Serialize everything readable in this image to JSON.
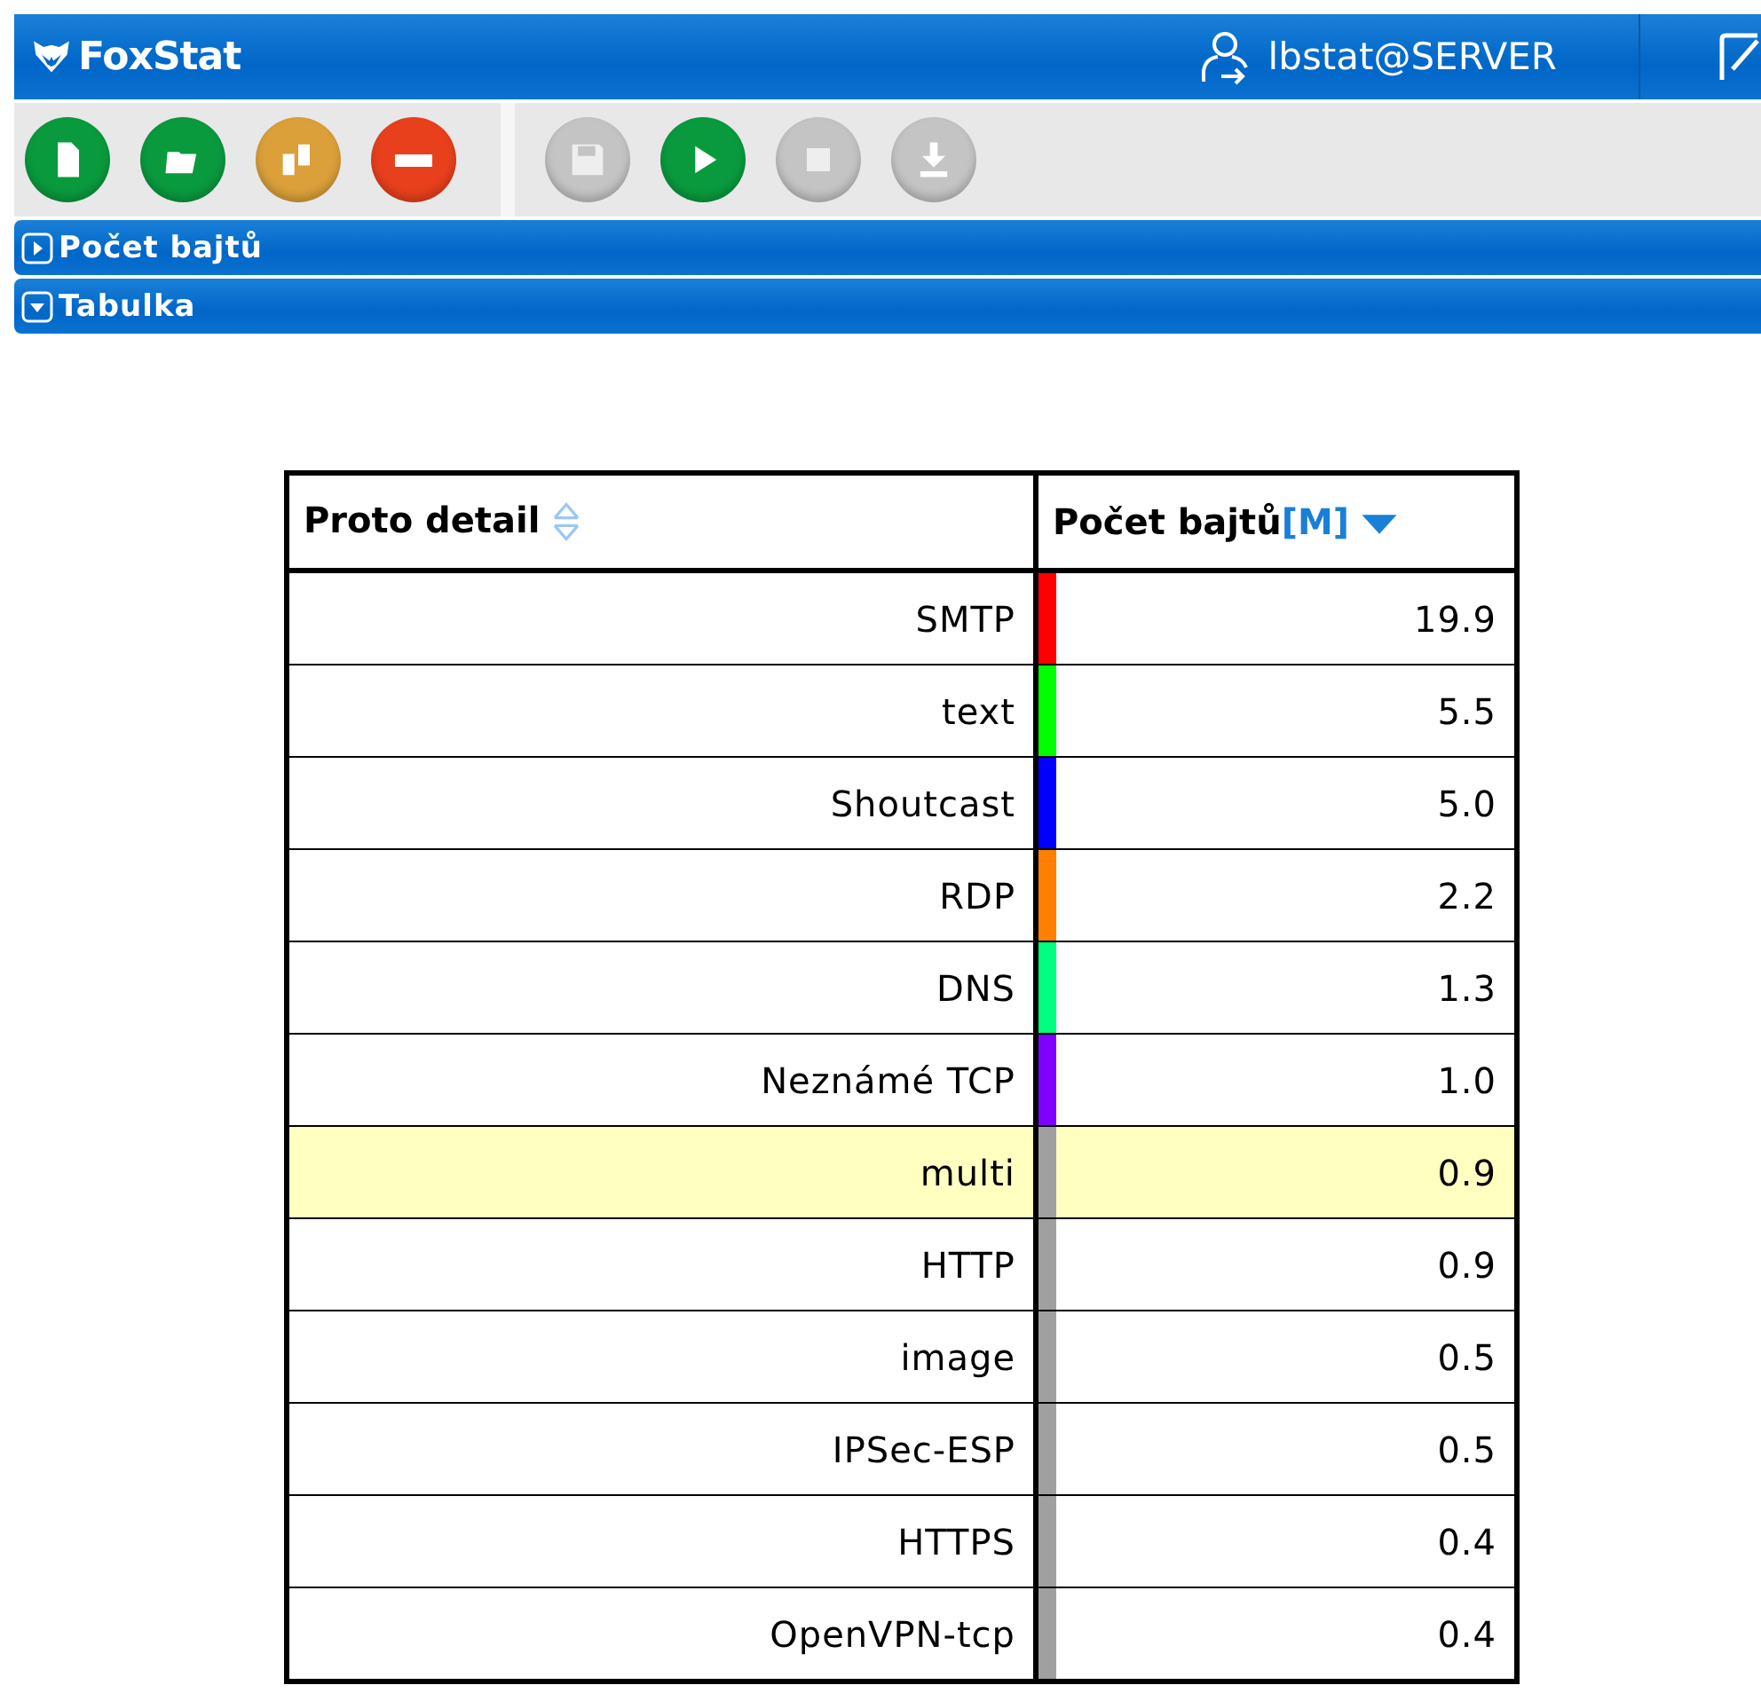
{
  "app": {
    "title": "FoxStat",
    "user": "lbstat@SERVER"
  },
  "toolbar": [
    {
      "kind": "new",
      "disabled": false
    },
    {
      "kind": "open",
      "disabled": false
    },
    {
      "kind": "copy",
      "disabled": false
    },
    {
      "kind": "remove",
      "disabled": false
    },
    {
      "kind": "save",
      "disabled": true
    },
    {
      "kind": "play",
      "disabled": false
    },
    {
      "kind": "stop",
      "disabled": true
    },
    {
      "kind": "download",
      "disabled": true
    }
  ],
  "sections": [
    {
      "title": "Počet bajtů",
      "expanded": false
    },
    {
      "title": "Tabulka",
      "expanded": true
    }
  ],
  "table": {
    "columns": [
      {
        "label": "Proto detail",
        "sorted": false
      },
      {
        "label": "Počet bajtů",
        "unit": "[M]",
        "sorted": true
      }
    ],
    "rows": [
      {
        "name": "SMTP",
        "value": "19.9",
        "color": "#ff0000",
        "selected": false
      },
      {
        "name": "text",
        "value": "5.5",
        "color": "#00ff00",
        "selected": false
      },
      {
        "name": "Shoutcast",
        "value": "5.0",
        "color": "#0000ff",
        "selected": false
      },
      {
        "name": "RDP",
        "value": "2.2",
        "color": "#ff8000",
        "selected": false
      },
      {
        "name": "DNS",
        "value": "1.3",
        "color": "#00ff80",
        "selected": false
      },
      {
        "name": "Neznámé TCP",
        "value": "1.0",
        "color": "#8000ff",
        "selected": false
      },
      {
        "name": "multi",
        "value": "0.9",
        "color": "#a0a0a0",
        "selected": true
      },
      {
        "name": "HTTP",
        "value": "0.9",
        "color": "#a0a0a0",
        "selected": false
      },
      {
        "name": "image",
        "value": "0.5",
        "color": "#a0a0a0",
        "selected": false
      },
      {
        "name": "IPSec-ESP",
        "value": "0.5",
        "color": "#a0a0a0",
        "selected": false
      },
      {
        "name": "HTTPS",
        "value": "0.4",
        "color": "#a0a0a0",
        "selected": false
      },
      {
        "name": "OpenVPN-tcp",
        "value": "0.4",
        "color": "#a0a0a0",
        "selected": false
      }
    ]
  }
}
